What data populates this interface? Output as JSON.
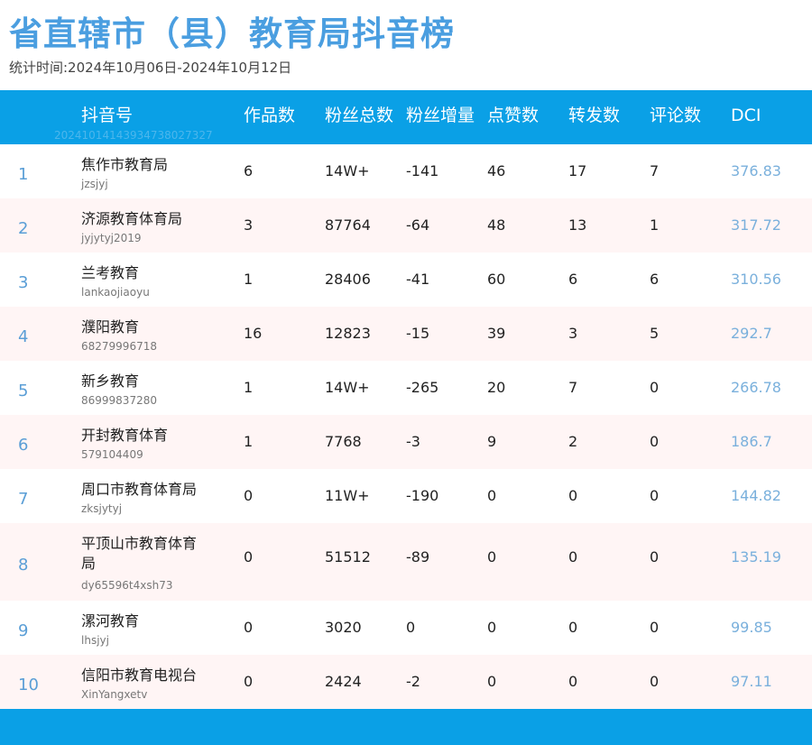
{
  "title": "省直辖市（县）教育局抖音榜",
  "subtitle": "统计时间:2024年10月06日-2024年10月12日",
  "header": {
    "account": "抖音号",
    "works": "作品数",
    "fans_total": "粉丝总数",
    "fans_growth": "粉丝增量",
    "likes": "点赞数",
    "shares": "转发数",
    "comments": "评论数",
    "dci": "DCI",
    "batch_id": "20241014143934738027327"
  },
  "rows": [
    {
      "rank": "1",
      "name": "焦作市教育局",
      "account": "jzsjyj",
      "works": "6",
      "fans_total": "14W+",
      "fans_growth": "-141",
      "likes": "46",
      "shares": "17",
      "comments": "7",
      "dci": "376.83"
    },
    {
      "rank": "2",
      "name": "济源教育体育局",
      "account": "jyjytyj2019",
      "works": "3",
      "fans_total": "87764",
      "fans_growth": "-64",
      "likes": "48",
      "shares": "13",
      "comments": "1",
      "dci": "317.72"
    },
    {
      "rank": "3",
      "name": "兰考教育",
      "account": "lankaojiaoyu",
      "works": "1",
      "fans_total": "28406",
      "fans_growth": "-41",
      "likes": "60",
      "shares": "6",
      "comments": "6",
      "dci": "310.56"
    },
    {
      "rank": "4",
      "name": "濮阳教育",
      "account": "68279996718",
      "works": "16",
      "fans_total": "12823",
      "fans_growth": "-15",
      "likes": "39",
      "shares": "3",
      "comments": "5",
      "dci": "292.7"
    },
    {
      "rank": "5",
      "name": "新乡教育",
      "account": "86999837280",
      "works": "1",
      "fans_total": "14W+",
      "fans_growth": "-265",
      "likes": "20",
      "shares": "7",
      "comments": "0",
      "dci": "266.78"
    },
    {
      "rank": "6",
      "name": "开封教育体育",
      "account": "579104409",
      "works": "1",
      "fans_total": "7768",
      "fans_growth": "-3",
      "likes": "9",
      "shares": "2",
      "comments": "0",
      "dci": "186.7"
    },
    {
      "rank": "7",
      "name": "周口市教育体育局",
      "account": "zksjytyj",
      "works": "0",
      "fans_total": "11W+",
      "fans_growth": "-190",
      "likes": "0",
      "shares": "0",
      "comments": "0",
      "dci": "144.82"
    },
    {
      "rank": "8",
      "name": "平顶山市教育体育局",
      "account": "dy65596t4xsh73",
      "works": "0",
      "fans_total": "51512",
      "fans_growth": "-89",
      "likes": "0",
      "shares": "0",
      "comments": "0",
      "dci": "135.19"
    },
    {
      "rank": "9",
      "name": "漯河教育",
      "account": "lhsjyj",
      "works": "0",
      "fans_total": "3020",
      "fans_growth": "0",
      "likes": "0",
      "shares": "0",
      "comments": "0",
      "dci": "99.85"
    },
    {
      "rank": "10",
      "name": "信阳市教育电视台",
      "account": "XinYangxetv",
      "works": "0",
      "fans_total": "2424",
      "fans_growth": "-2",
      "likes": "0",
      "shares": "0",
      "comments": "0",
      "dci": "97.11"
    }
  ],
  "colors": {
    "header_bg": "#0aa0e6",
    "title": "#4a9ee0",
    "rank": "#5a9ed6",
    "dci": "#7ab0dc",
    "alt_row": "#fff5f5"
  }
}
